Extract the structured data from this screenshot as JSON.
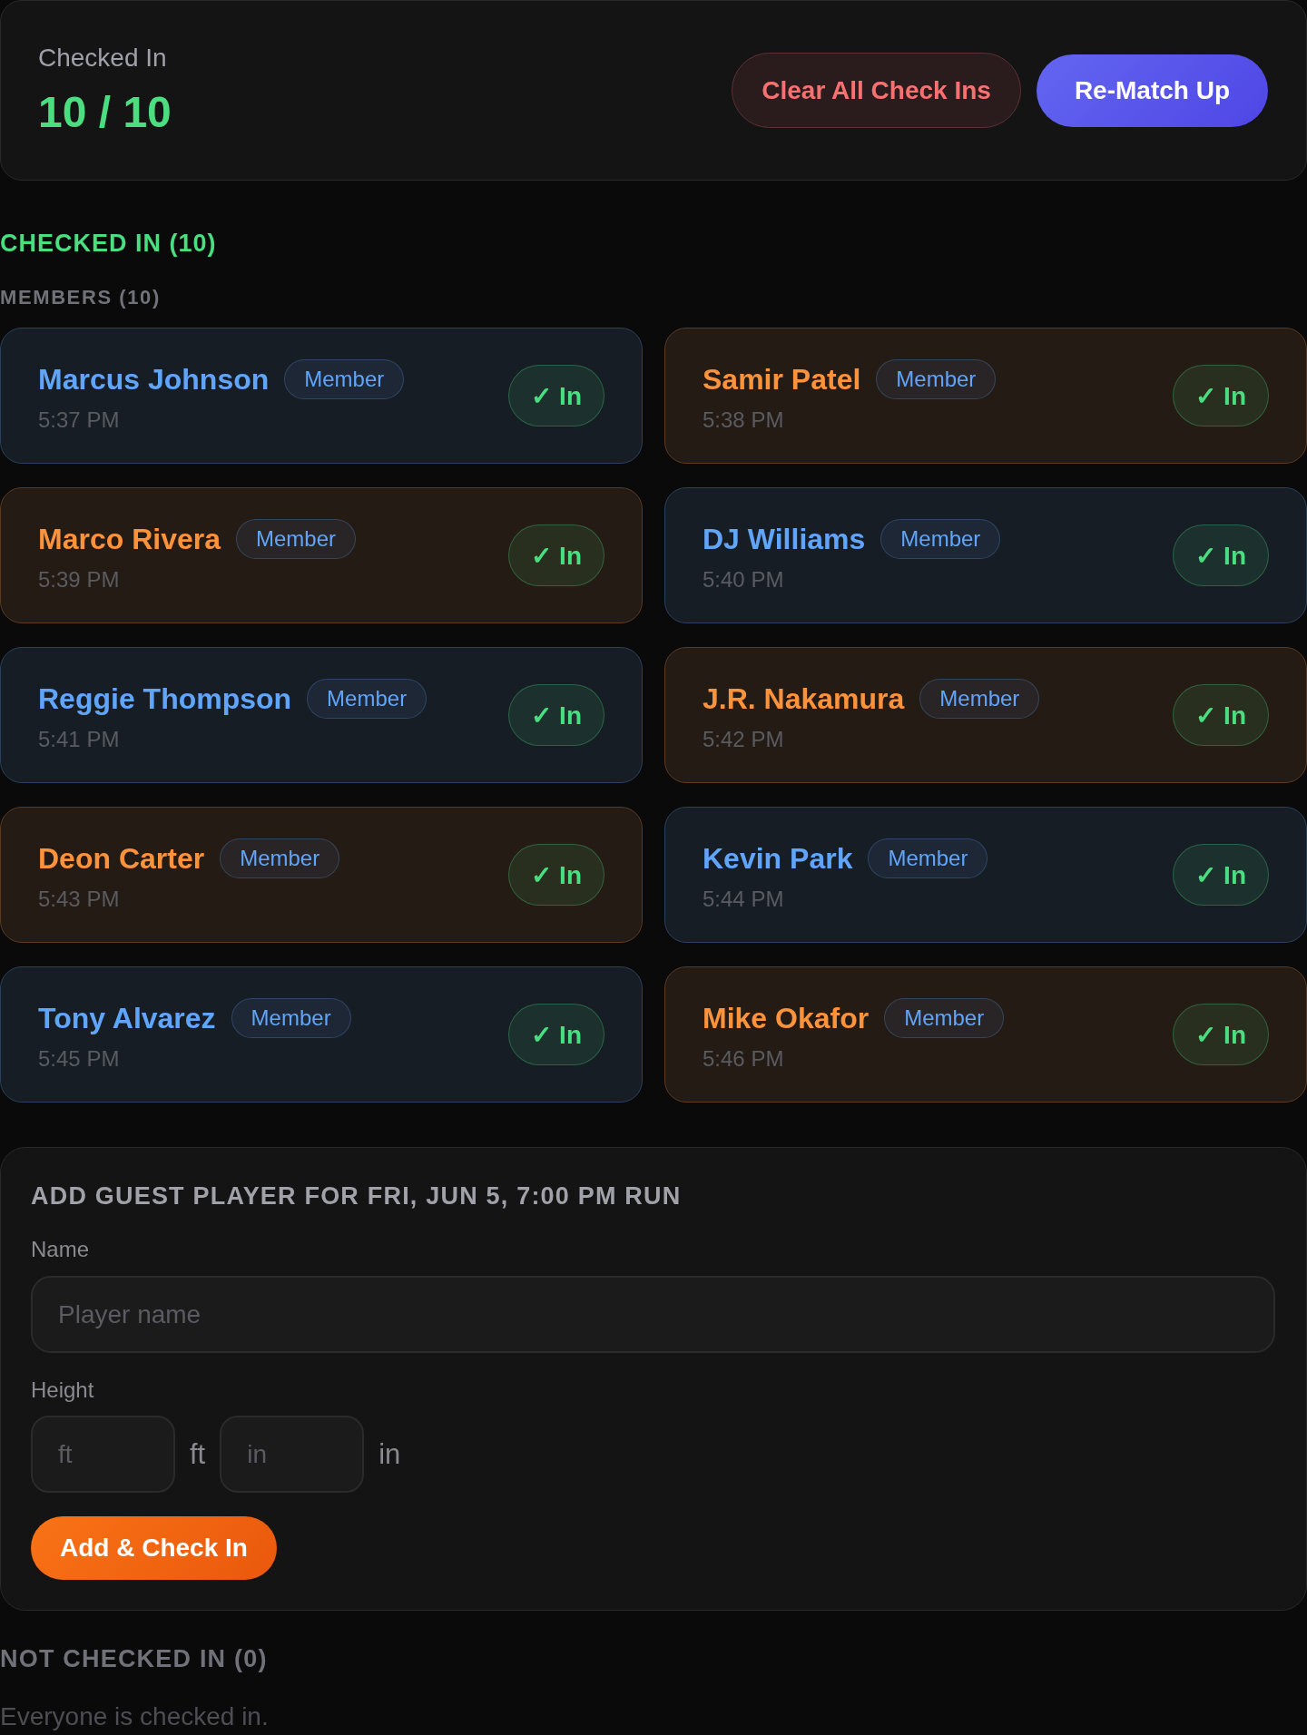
{
  "summary": {
    "label": "Checked In",
    "count": "10 / 10"
  },
  "actions": [
    {
      "label": "Clear All Check Ins",
      "kind": "danger"
    },
    {
      "label": "Re-Match Up",
      "kind": "primary"
    }
  ],
  "checked_in": {
    "heading": "CHECKED IN (10)",
    "group_heading": "MEMBERS (10)",
    "members": [
      {
        "name": "Marcus Johnson",
        "color": "#60a5fa",
        "badge": "Member",
        "time": "5:37 PM",
        "status": "✓ In",
        "checked_in": true
      },
      {
        "name": "Samir Patel",
        "color": "#fb923c",
        "badge": "Member",
        "time": "5:38 PM",
        "status": "✓ In",
        "checked_in": true
      },
      {
        "name": "Marco Rivera",
        "color": "#fb923c",
        "badge": "Member",
        "time": "5:39 PM",
        "status": "✓ In",
        "checked_in": true
      },
      {
        "name": "DJ Williams",
        "color": "#60a5fa",
        "badge": "Member",
        "time": "5:40 PM",
        "status": "✓ In",
        "checked_in": true
      },
      {
        "name": "Reggie Thompson",
        "color": "#60a5fa",
        "badge": "Member",
        "time": "5:41 PM",
        "status": "✓ In",
        "checked_in": true
      },
      {
        "name": "J.R. Nakamura",
        "color": "#fb923c",
        "badge": "Member",
        "time": "5:42 PM",
        "status": "✓ In",
        "checked_in": true
      },
      {
        "name": "Deon Carter",
        "color": "#fb923c",
        "badge": "Member",
        "time": "5:43 PM",
        "status": "✓ In",
        "checked_in": true
      },
      {
        "name": "Kevin Park",
        "color": "#60a5fa",
        "badge": "Member",
        "time": "5:44 PM",
        "status": "✓ In",
        "checked_in": true
      },
      {
        "name": "Tony Alvarez",
        "color": "#60a5fa",
        "badge": "Member",
        "time": "5:45 PM",
        "status": "✓ In",
        "checked_in": true
      },
      {
        "name": "Mike Okafor",
        "color": "#fb923c",
        "badge": "Member",
        "time": "5:46 PM",
        "status": "✓ In",
        "checked_in": true
      }
    ]
  },
  "guest_form": {
    "title": "ADD GUEST PLAYER FOR FRI, JUN 5, 7:00 PM RUN",
    "name_field": {
      "label": "Name",
      "placeholder": "Player name"
    },
    "height_field": {
      "label": "Height",
      "feet": {
        "placeholder": "ft",
        "unit": "ft"
      },
      "inches": {
        "placeholder": "in",
        "unit": "in"
      }
    },
    "submit": "Add & Check In"
  },
  "not_checked_in": {
    "heading": "NOT CHECKED IN (0)",
    "empty_message": "Everyone is checked in."
  }
}
